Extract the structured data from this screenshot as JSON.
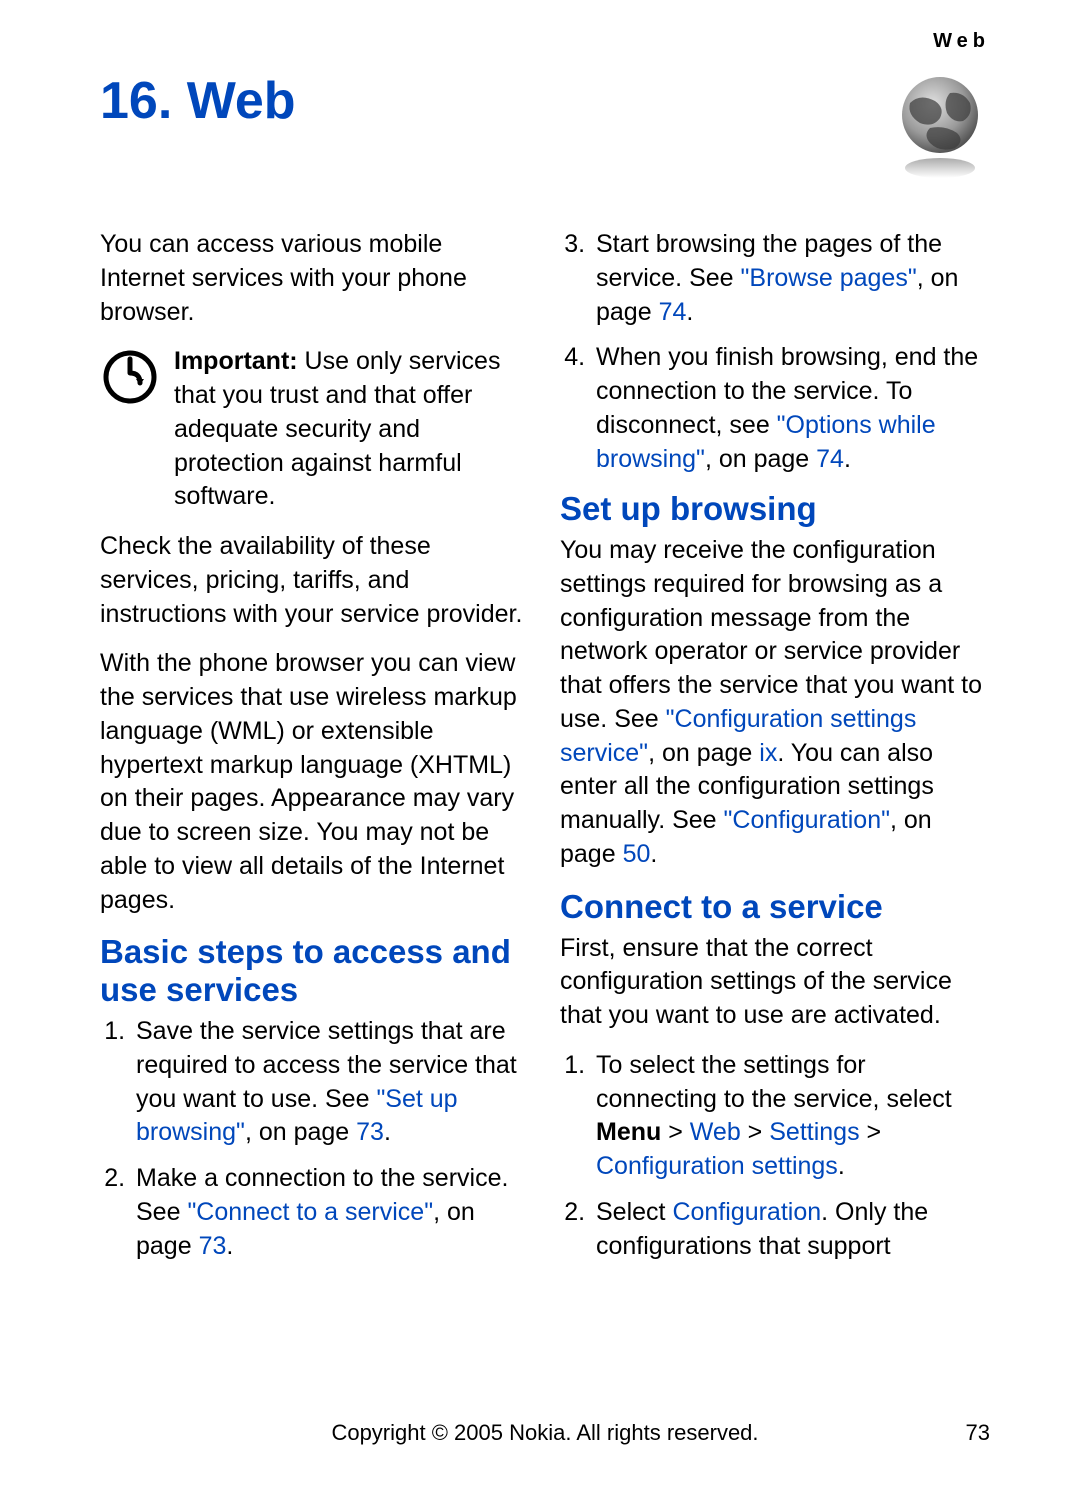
{
  "running_head": "Web",
  "chapter_title": "16. Web",
  "intro_p1": "You can access various mobile Internet services with your phone browser.",
  "important_label": "Important:",
  "important_body": " Use only services that you trust and that offer adequate security and protection against harmful software.",
  "intro_p2": "Check the availability of these services, pricing, tariffs, and instructions with your service provider.",
  "intro_p3": "With the phone browser you can view the services that use wireless markup language (WML) or extensible hypertext markup language (XHTML) on their pages. Appearance may vary due to screen size. You may not be able to view all details of the Internet pages.",
  "section_basic": "Basic steps to access and use services",
  "step1_pre": "Save the service settings that are required to access the service that you want to use. See ",
  "step1_link": "\"Set up browsing\"",
  "step1_post_a": ", on page ",
  "step1_page": "73",
  "step1_dot": ".",
  "step2_pre": "Make a connection to the service. See ",
  "step2_link": "\"Connect to a service\"",
  "step2_post_a": ", on page ",
  "step2_page": "73",
  "step2_dot": ".",
  "step3_pre": "Start browsing the pages of the service. See ",
  "step3_link": "\"Browse pages\"",
  "step3_post_a": ", on page ",
  "step3_page": "74",
  "step3_dot": ".",
  "step4_pre": "When you finish browsing, end the connection to the service. To disconnect, see ",
  "step4_link": "\"Options while browsing\"",
  "step4_post_a": ", on page ",
  "step4_page": "74",
  "step4_dot": ".",
  "section_setup": "Set up browsing",
  "setup_p1_a": "You may receive the configuration settings required for browsing as a configuration message from the network operator or service provider that offers the service that you want to use. See ",
  "setup_link1": "\"Configuration settings service\"",
  "setup_p1_b": ", on page ",
  "setup_page1": "ix",
  "setup_p1_c": ". You can also enter all the configuration settings manually. See ",
  "setup_link2": "\"Configuration\"",
  "setup_p1_d": ", on page ",
  "setup_page2": "50",
  "setup_p1_e": ".",
  "section_connect": "Connect to a service",
  "connect_p1": "First, ensure that the correct configuration settings of the service that you want to use are activated.",
  "connect_s1_a": "To select the settings for connecting to the service, select ",
  "connect_menu": "Menu",
  "gt": " > ",
  "connect_web": "Web",
  "connect_settings": "Settings",
  "connect_cfg": "Configuration settings",
  "connect_s1_dot": ".",
  "connect_s2_a": "Select ",
  "connect_s2_cfg": "Configuration",
  "connect_s2_b": ". Only the configurations that support",
  "footer_center": "Copyright © 2005 Nokia. All rights reserved.",
  "footer_right": "73"
}
